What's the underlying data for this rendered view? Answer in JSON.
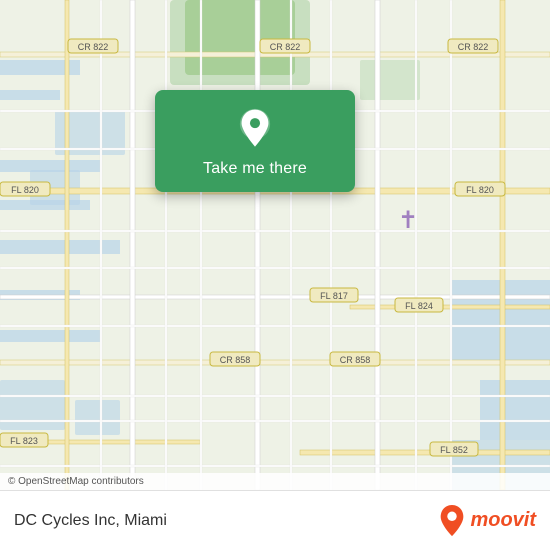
{
  "map": {
    "attribution": "© OpenStreetMap contributors",
    "location_card": {
      "button_label": "Take me there"
    }
  },
  "bottom_bar": {
    "title": "DC Cycles Inc, Miami"
  },
  "moovit": {
    "label": "moovit"
  },
  "roads": {
    "labels": [
      "CR 822",
      "FL 820",
      "FL 817",
      "CR 858",
      "FL 823",
      "FL 824",
      "FL 852"
    ]
  }
}
